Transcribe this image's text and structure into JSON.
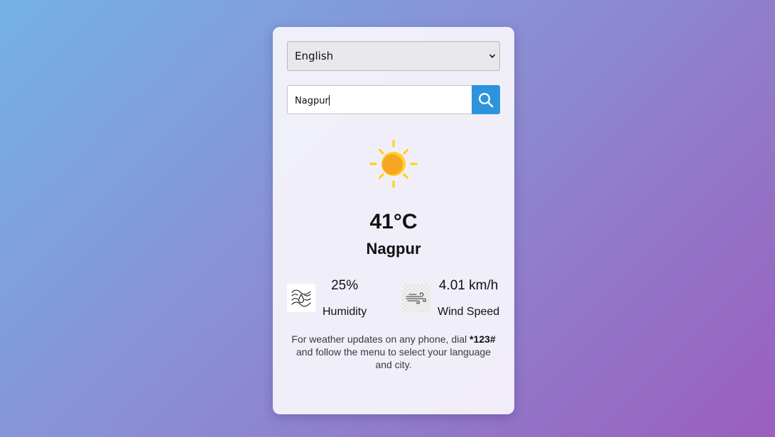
{
  "language_select": {
    "value": "English"
  },
  "search": {
    "value": "Nagpur"
  },
  "weather": {
    "icon": "sun-icon",
    "temperature": "41°C",
    "city": "Nagpur"
  },
  "details": {
    "humidity": {
      "icon": "humidity-icon",
      "value": "25%",
      "label": "Humidity"
    },
    "wind": {
      "icon": "wind-icon",
      "value": "4.01 km/h",
      "label": "Wind Speed"
    }
  },
  "footnote": {
    "text_before": "For weather updates on any phone, dial ",
    "dial_code": "*123#",
    "text_after": " and follow the menu to select your language and city."
  },
  "colors": {
    "search_button": "#2d93dc",
    "sun_rays": "#ffd21f",
    "sun_core": "#f6a623"
  }
}
